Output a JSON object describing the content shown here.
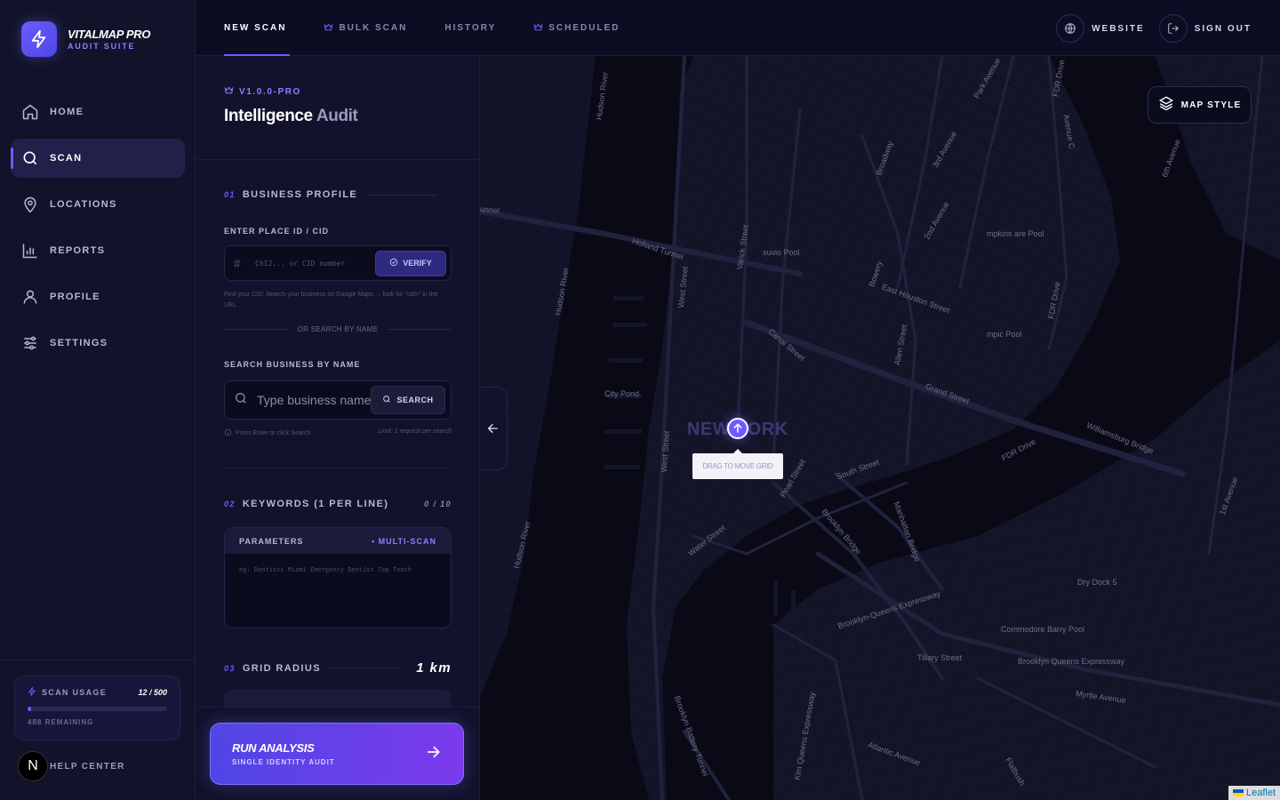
{
  "brand": {
    "name": "VITALMAP PRO",
    "subtitle": "AUDIT SUITE"
  },
  "sidebar": {
    "items": [
      {
        "label": "HOME",
        "icon": "home-icon"
      },
      {
        "label": "SCAN",
        "icon": "search-icon",
        "active": true
      },
      {
        "label": "LOCATIONS",
        "icon": "map-pin-icon"
      },
      {
        "label": "REPORTS",
        "icon": "bar-chart-icon"
      },
      {
        "label": "PROFILE",
        "icon": "user-icon"
      },
      {
        "label": "SETTINGS",
        "icon": "sliders-icon"
      }
    ],
    "usage": {
      "title": "SCAN USAGE",
      "count": "12 / 500",
      "fraction": 0.024,
      "remaining": "488 REMAINING"
    },
    "help": {
      "avatar": "N",
      "label": "HELP CENTER"
    }
  },
  "topbar": {
    "tabs": [
      {
        "label": "NEW SCAN",
        "active": true
      },
      {
        "label": "BULK SCAN",
        "icon": "crown-icon"
      },
      {
        "label": "HISTORY"
      },
      {
        "label": "SCHEDULED",
        "icon": "crown-icon"
      }
    ],
    "actions": {
      "website": "WEBSITE",
      "sign_out": "SIGN OUT"
    }
  },
  "panel": {
    "version": "V1.0.0-PRO",
    "title_main": "Intelligence",
    "title_muted": "Audit",
    "business": {
      "num": "01",
      "title": "BUSINESS PROFILE",
      "place_label": "ENTER PLACE ID / CID",
      "place_placeholder": "ChIJ... or CID number",
      "verify": "VERIFY",
      "hint": "Find your CID: Search your business on Google Maps → look for \"cid=\" in the URL",
      "or": "OR SEARCH BY NAME",
      "search_label": "SEARCH BUSINESS BY NAME",
      "search_placeholder": "Type business name...",
      "search_button": "SEARCH",
      "press_hint": "Press Enter or click Search",
      "limit_hint": "Limit: 1 request per search"
    },
    "keywords": {
      "num": "02",
      "title": "KEYWORDS (1 PER LINE)",
      "count": "0 / 10",
      "params": "PARAMETERS",
      "mode": "• MULTI-SCAN",
      "placeholder": "eg: Dentists Miami Emergency Dentist Top Tooth"
    },
    "radius": {
      "num": "03",
      "title": "GRID RADIUS",
      "value": "1 km"
    },
    "run": {
      "title": "RUN ANALYSIS",
      "subtitle": "SINGLE IDENTITY AUDIT"
    }
  },
  "map": {
    "style_button": "MAP STYLE",
    "city": "NEW YORK",
    "drag_hint": "DRAG TO MOVE GRID",
    "attribution": "Leaflet",
    "labels": [
      "Holland Tunnel",
      "unnel",
      "Hudson River",
      "Hudson River",
      "Hudson River",
      "Canal Street",
      "Grand Street",
      "East Houston Street",
      "Broadway",
      "Bowery",
      "Williamsburg Bridge",
      "FDR Drive",
      "FDR Drive",
      "FDR Drive",
      "South Street",
      "Water Street",
      "Brooklyn Bridge",
      "Manhattan Bridge",
      "Brooklyn-Queens Expressway",
      "Tillary Street",
      "Myrtle Avenue",
      "Atlantic Avenue",
      "West Street",
      "West Street",
      "Varick Street",
      "2nd Avenue",
      "1st Avenue",
      "3rd Avenue",
      "Park Avenue",
      "Avenue C",
      "Allen Street",
      "Pearl Street",
      "Brooklyn Battery Tunnel",
      "Kim Queens Expressway",
      "Commodore Barry Pool",
      "Dry Dock 5",
      "City Pond",
      "suvio Pool",
      "mpkins are Pool",
      "mpic Pool",
      "Brooklyn Queens Expressway",
      "6th Avenue",
      "Flatbush"
    ]
  },
  "colors": {
    "accent": "#6b5cff",
    "background": "#0b0b1e",
    "sidebar": "#12122a",
    "map_water": "#0a0a16",
    "map_land": "#15152a"
  }
}
